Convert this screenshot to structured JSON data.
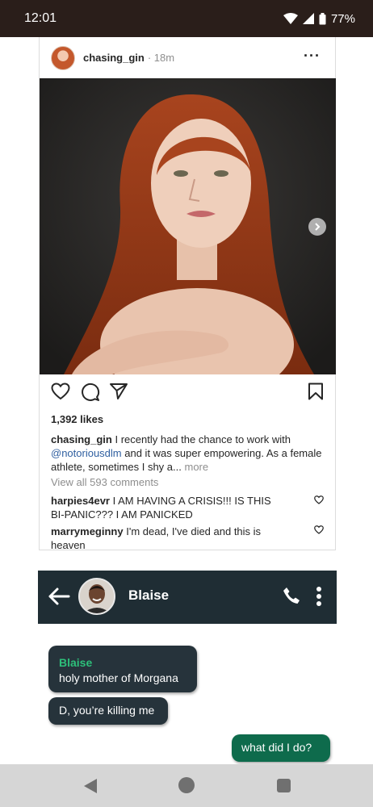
{
  "status": {
    "time": "12:01",
    "battery": "77%"
  },
  "post": {
    "username": "chasing_gin",
    "time": "· 18m",
    "likes": "1,392 likes",
    "caption_user": "chasing_gin",
    "caption_pre": "I recently had the chance to work with",
    "caption_mention": "@notoriousdlm",
    "caption_post": "and it was super empowering. As a female athlete, sometimes I shy a...",
    "caption_more": "more",
    "view_all": "View all 593 comments",
    "comments": [
      {
        "user": "harpies4evr",
        "text": "I AM HAVING A CRISIS!!! IS THIS BI-PANIC??? I AM PANICKED"
      },
      {
        "user": "marrymeginny",
        "text": "I'm dead, I've died and this is heaven"
      }
    ]
  },
  "chat": {
    "contact_name": "Blaise",
    "messages": [
      {
        "sender": "Blaise",
        "text": "holy mother of Morgana"
      },
      {
        "text": "D, you’re killing me"
      },
      {
        "text": "what did I do?"
      }
    ]
  },
  "colors": {
    "status_bg": "#2a1e1a",
    "chat_header_bg": "#1f2d34",
    "incoming_bubble": "#26333b",
    "outgoing_bubble": "#0e6b4c",
    "sender_name": "#2dbf7a",
    "mention": "#2f5fa0"
  },
  "icons": [
    "wifi-icon",
    "signal-icon",
    "battery-icon",
    "more-icon",
    "next-arrow-icon",
    "heart-icon",
    "comment-icon",
    "share-icon",
    "bookmark-icon",
    "back-arrow-icon",
    "phone-icon",
    "kebab-menu-icon",
    "nav-back-icon",
    "nav-home-icon",
    "nav-recents-icon"
  ]
}
